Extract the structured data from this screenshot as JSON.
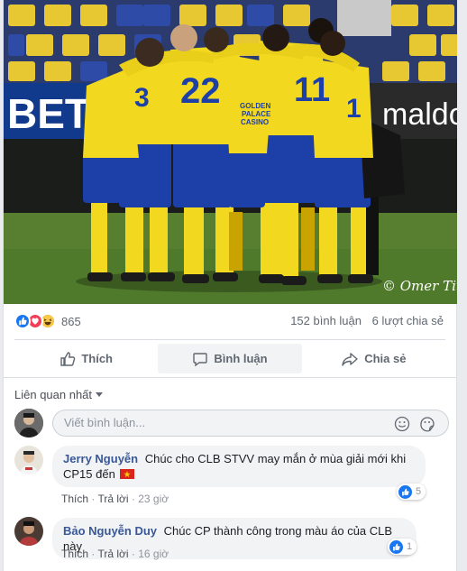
{
  "post": {
    "photo_watermark": "© Omer Tits",
    "reaction_count": "865",
    "comment_count": "152 bình luận",
    "share_count": "6 lượt chia sẻ",
    "reactions": [
      "like-icon",
      "love-icon",
      "haha-icon"
    ],
    "jersey_numbers": [
      "3",
      "22",
      "11",
      "1"
    ],
    "banner_text": [
      "BETO",
      "maldo"
    ],
    "sponsor_text": [
      "GOLDEN",
      "PALACE",
      "CASINO"
    ]
  },
  "actions": [
    {
      "label": "Thích",
      "icon": "thumbs-up-icon"
    },
    {
      "label": "Bình luận",
      "icon": "comment-icon"
    },
    {
      "label": "Chia sẻ",
      "icon": "share-icon"
    }
  ],
  "comments_section": {
    "sort_label": "Liên quan nhất",
    "composer_placeholder": "Viết bình luận..."
  },
  "comments": [
    {
      "author": "Jerry Nguyễn",
      "text_line1": "Chúc cho CLB STVV may mắn ở mùa giải mới khi",
      "text_line2": "CP15 đến",
      "flag_icon": "vietnam-flag-icon",
      "like_label": "Thích",
      "reply_label": "Trả lời",
      "time": "23 giờ",
      "likes": "5"
    },
    {
      "author": "Bảo Nguyễn Duy",
      "text_line1": "Chúc CP thành công trong màu áo của CLB này",
      "like_label": "Thích",
      "reply_label": "Trả lời",
      "time": "16 giờ",
      "likes": "1"
    }
  ],
  "colors": {
    "facebook_blue": "#1877f2",
    "link_blue": "#385898",
    "jersey_yellow": "#f2d81e",
    "shorts_blue": "#1d3fa8"
  }
}
